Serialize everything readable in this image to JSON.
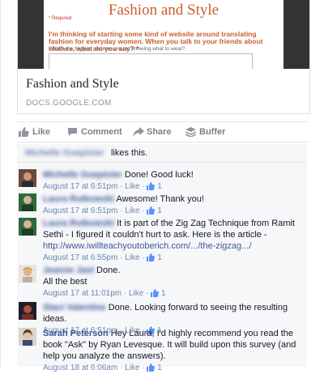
{
  "preview": {
    "doc_title": "Fashion and Style",
    "doc_required": "* Required",
    "doc_question": "I'm thinking of starting some kind of website around translating fashion for everyday women. When you talk to your friends about clothes, what do you say? *",
    "doc_help": "What's the biggest problem around knowing what to wear?",
    "title": "Fashion and Style",
    "domain": "DOCS.GOOGLE.COM"
  },
  "actions": {
    "like": "Like",
    "comment": "Comment",
    "share": "Share",
    "buffer": "Buffer"
  },
  "likes_summary": {
    "name": "Michelle Guepinier",
    "text": "likes this."
  },
  "comments": [
    {
      "name": "Michelle Guepinier",
      "text": "Done! Good luck!",
      "time": "August 17 at 6:51pm",
      "like": "Like",
      "count": "1"
    },
    {
      "name": "Laura Rutkowski",
      "text": "Awesome! Thank you!",
      "time": "August 17 at 6:51pm",
      "like": "Like",
      "count": "1"
    },
    {
      "name": "Laura Rutkowski",
      "text": "It is part of the Zig Zag Technique from Ramit Sethi - I figured it couldn't hurt to ask. Here is the article - ",
      "link": "http://www.iwillteachyoutoberich.com/.../the-zigzag.../",
      "time": "August 17 at 6:55pm",
      "like": "Like",
      "count": "1"
    },
    {
      "name": "Jeanne Jast",
      "text": "Done.",
      "text2": "All the best",
      "time": "August 17 at 11:01pm",
      "like": "Like",
      "count": "1"
    },
    {
      "name": "Staci Valentine",
      "text": "Done. Looking forward to seeing the resulting ideas.",
      "time": "August 17 at 6:51pm",
      "like": "Like",
      "count": "1"
    },
    {
      "name": "Sarah Peterson",
      "text": "Hey Laura, I'd highly recommend you read the book \"Ask\" by Ryan Levesque. It will build upon this survey (and help you analyze the answers).",
      "time": "August 18 at 6:06am",
      "like": "Like",
      "count": "1"
    }
  ],
  "colors": {
    "link": "#3b5998",
    "meta": "#90949c",
    "accent": "#c75f2e"
  }
}
